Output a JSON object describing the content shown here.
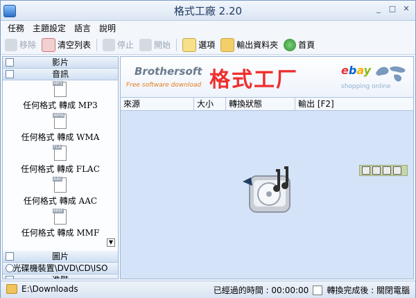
{
  "window": {
    "title": "格式工廠 2.20",
    "controls": [
      "_",
      "□",
      "✕"
    ]
  },
  "menu": [
    "任務",
    "主題設定",
    "語言",
    "說明"
  ],
  "toolbar": {
    "remove": "移除",
    "clear": "清空列表",
    "stop": "停止",
    "start": "開始",
    "options": "選項",
    "output_folder": "輸出資料夾",
    "home": "首頁"
  },
  "sidebar": {
    "categories": {
      "video": "影片",
      "audio": "音訊",
      "image": "圖片",
      "disc": "光碟機裝置\\DVD\\CD\\ISO",
      "advanced": "進階"
    },
    "audio_items": [
      {
        "tag": "MP3",
        "label": "任何格式 轉成 MP3"
      },
      {
        "tag": "WMA",
        "label": "任何格式 轉成 WMA"
      },
      {
        "tag": "FLA",
        "label": "任何格式 轉成 FLAC"
      },
      {
        "tag": "AAC",
        "label": "任何格式 轉成 AAC"
      },
      {
        "tag": "MMF",
        "label": "任何格式 轉成 MMF"
      }
    ]
  },
  "banner": {
    "brand": "Brothersoft",
    "brand_sub": "Free software download",
    "headline": "格式工厂",
    "ebay": "ebay",
    "shopping": "shopping online"
  },
  "table": {
    "columns": [
      "來源",
      "大小",
      "轉換狀態",
      "輸出 [F2]"
    ]
  },
  "status": {
    "path": "E:\\Downloads",
    "elapsed_label": "已經過的時間 : 00:00:00",
    "after_label": "轉換完成後 : 關閉電腦"
  }
}
